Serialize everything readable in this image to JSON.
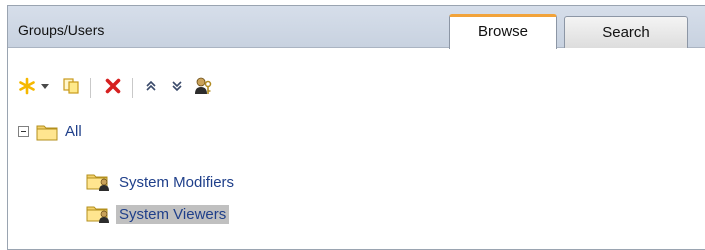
{
  "header": {
    "title": "Groups/Users"
  },
  "tabs": [
    {
      "label": "Browse",
      "active": true
    },
    {
      "label": "Search",
      "active": false
    }
  ],
  "toolbar": {
    "buttons": [
      {
        "icon": "new-star-icon",
        "action": "new"
      },
      {
        "icon": "dropdown-arrow-icon",
        "action": "new-menu"
      },
      {
        "icon": "duplicate-icon",
        "action": "duplicate"
      },
      {
        "icon": "delete-x-icon",
        "action": "delete"
      },
      {
        "icon": "collapse-all-icon",
        "action": "collapse"
      },
      {
        "icon": "expand-all-icon",
        "action": "expand"
      },
      {
        "icon": "user-key-icon",
        "action": "permissions"
      }
    ]
  },
  "tree": {
    "root": {
      "label": "All",
      "expanded": true
    },
    "children": [
      {
        "label": "System Modifiers",
        "selected": false
      },
      {
        "label": "System Viewers",
        "selected": true
      }
    ]
  },
  "colors": {
    "header_bg": "#cfd8e4",
    "active_tab_accent": "#f2a33a",
    "link_text": "#1f3f8a",
    "selection_bg": "#c0c0c0",
    "delete_red": "#d62020",
    "new_star_yellow": "#f5b800"
  }
}
